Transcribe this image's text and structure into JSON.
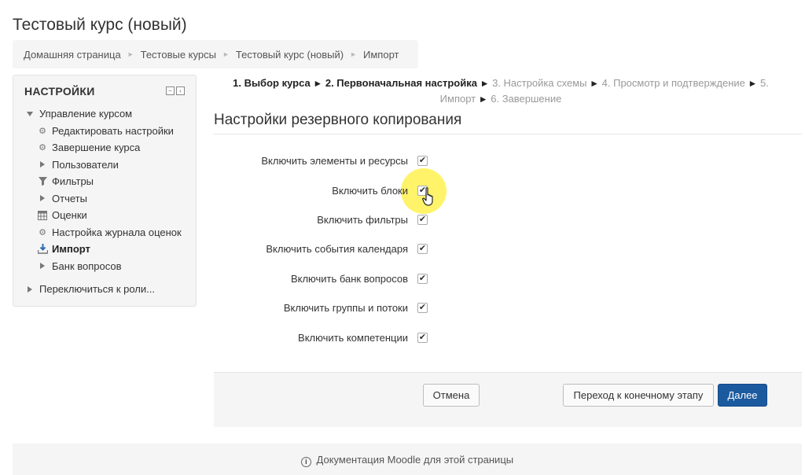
{
  "page": {
    "title": "Тестовый курс (новый)"
  },
  "breadcrumb": [
    "Домашняя страница",
    "Тестовые курсы",
    "Тестовый курс (новый)",
    "Импорт"
  ],
  "settings": {
    "title": "НАСТРОЙКИ",
    "items": [
      {
        "label": "Управление курсом",
        "icon": "caret-down-icon"
      },
      {
        "label": "Редактировать настройки",
        "icon": "gear-icon"
      },
      {
        "label": "Завершение курса",
        "icon": "gear-icon"
      },
      {
        "label": "Пользователи",
        "icon": "caret-right-icon"
      },
      {
        "label": "Фильтры",
        "icon": "filter-icon"
      },
      {
        "label": "Отчеты",
        "icon": "caret-right-icon"
      },
      {
        "label": "Оценки",
        "icon": "table-icon"
      },
      {
        "label": "Настройка журнала оценок",
        "icon": "gear-icon"
      },
      {
        "label": "Импорт",
        "icon": "import-icon"
      },
      {
        "label": "Банк вопросов",
        "icon": "caret-right-icon"
      }
    ],
    "switch_role": "Переключиться к роли..."
  },
  "steps": {
    "step1": "1. Выбор курса",
    "step2": "2. Первоначальная настройка",
    "step3": "3. Настройка схемы",
    "step4": "4. Просмотр и подтверждение",
    "step5": "5. Импорт",
    "step6": "6. Завершение"
  },
  "section_title": "Настройки резервного копирования",
  "options": [
    {
      "label": "Включить элементы и ресурсы",
      "checked": true
    },
    {
      "label": "Включить блоки",
      "checked": true
    },
    {
      "label": "Включить фильтры",
      "checked": true
    },
    {
      "label": "Включить события календаря",
      "checked": true
    },
    {
      "label": "Включить банк вопросов",
      "checked": true
    },
    {
      "label": "Включить группы и потоки",
      "checked": true
    },
    {
      "label": "Включить компетенции",
      "checked": true
    }
  ],
  "buttons": {
    "cancel": "Отмена",
    "final": "Переход к конечному этапу",
    "next": "Далее"
  },
  "footer": {
    "docs": "Документация Moodle для этой страницы"
  },
  "colors": {
    "primary": "#1c5aa0",
    "highlight": "#fff25a"
  }
}
